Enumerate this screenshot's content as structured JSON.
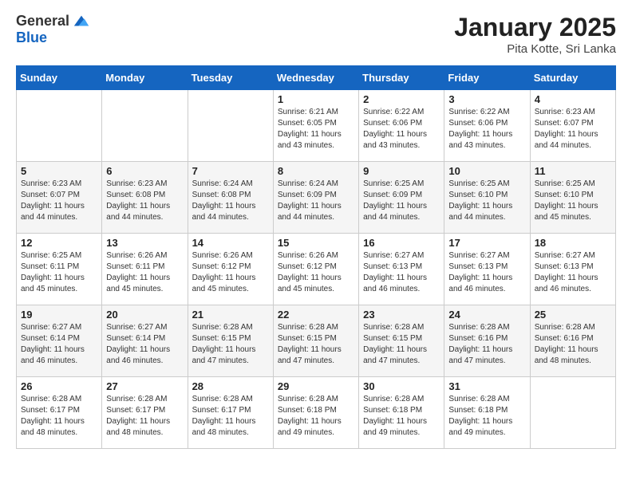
{
  "header": {
    "logo_general": "General",
    "logo_blue": "Blue",
    "title": "January 2025",
    "subtitle": "Pita Kotte, Sri Lanka"
  },
  "days_of_week": [
    "Sunday",
    "Monday",
    "Tuesday",
    "Wednesday",
    "Thursday",
    "Friday",
    "Saturday"
  ],
  "weeks": [
    [
      {
        "day": "",
        "info": ""
      },
      {
        "day": "",
        "info": ""
      },
      {
        "day": "",
        "info": ""
      },
      {
        "day": "1",
        "info": "Sunrise: 6:21 AM\nSunset: 6:05 PM\nDaylight: 11 hours and 43 minutes."
      },
      {
        "day": "2",
        "info": "Sunrise: 6:22 AM\nSunset: 6:06 PM\nDaylight: 11 hours and 43 minutes."
      },
      {
        "day": "3",
        "info": "Sunrise: 6:22 AM\nSunset: 6:06 PM\nDaylight: 11 hours and 43 minutes."
      },
      {
        "day": "4",
        "info": "Sunrise: 6:23 AM\nSunset: 6:07 PM\nDaylight: 11 hours and 44 minutes."
      }
    ],
    [
      {
        "day": "5",
        "info": "Sunrise: 6:23 AM\nSunset: 6:07 PM\nDaylight: 11 hours and 44 minutes."
      },
      {
        "day": "6",
        "info": "Sunrise: 6:23 AM\nSunset: 6:08 PM\nDaylight: 11 hours and 44 minutes."
      },
      {
        "day": "7",
        "info": "Sunrise: 6:24 AM\nSunset: 6:08 PM\nDaylight: 11 hours and 44 minutes."
      },
      {
        "day": "8",
        "info": "Sunrise: 6:24 AM\nSunset: 6:09 PM\nDaylight: 11 hours and 44 minutes."
      },
      {
        "day": "9",
        "info": "Sunrise: 6:25 AM\nSunset: 6:09 PM\nDaylight: 11 hours and 44 minutes."
      },
      {
        "day": "10",
        "info": "Sunrise: 6:25 AM\nSunset: 6:10 PM\nDaylight: 11 hours and 44 minutes."
      },
      {
        "day": "11",
        "info": "Sunrise: 6:25 AM\nSunset: 6:10 PM\nDaylight: 11 hours and 45 minutes."
      }
    ],
    [
      {
        "day": "12",
        "info": "Sunrise: 6:25 AM\nSunset: 6:11 PM\nDaylight: 11 hours and 45 minutes."
      },
      {
        "day": "13",
        "info": "Sunrise: 6:26 AM\nSunset: 6:11 PM\nDaylight: 11 hours and 45 minutes."
      },
      {
        "day": "14",
        "info": "Sunrise: 6:26 AM\nSunset: 6:12 PM\nDaylight: 11 hours and 45 minutes."
      },
      {
        "day": "15",
        "info": "Sunrise: 6:26 AM\nSunset: 6:12 PM\nDaylight: 11 hours and 45 minutes."
      },
      {
        "day": "16",
        "info": "Sunrise: 6:27 AM\nSunset: 6:13 PM\nDaylight: 11 hours and 46 minutes."
      },
      {
        "day": "17",
        "info": "Sunrise: 6:27 AM\nSunset: 6:13 PM\nDaylight: 11 hours and 46 minutes."
      },
      {
        "day": "18",
        "info": "Sunrise: 6:27 AM\nSunset: 6:13 PM\nDaylight: 11 hours and 46 minutes."
      }
    ],
    [
      {
        "day": "19",
        "info": "Sunrise: 6:27 AM\nSunset: 6:14 PM\nDaylight: 11 hours and 46 minutes."
      },
      {
        "day": "20",
        "info": "Sunrise: 6:27 AM\nSunset: 6:14 PM\nDaylight: 11 hours and 46 minutes."
      },
      {
        "day": "21",
        "info": "Sunrise: 6:28 AM\nSunset: 6:15 PM\nDaylight: 11 hours and 47 minutes."
      },
      {
        "day": "22",
        "info": "Sunrise: 6:28 AM\nSunset: 6:15 PM\nDaylight: 11 hours and 47 minutes."
      },
      {
        "day": "23",
        "info": "Sunrise: 6:28 AM\nSunset: 6:15 PM\nDaylight: 11 hours and 47 minutes."
      },
      {
        "day": "24",
        "info": "Sunrise: 6:28 AM\nSunset: 6:16 PM\nDaylight: 11 hours and 47 minutes."
      },
      {
        "day": "25",
        "info": "Sunrise: 6:28 AM\nSunset: 6:16 PM\nDaylight: 11 hours and 48 minutes."
      }
    ],
    [
      {
        "day": "26",
        "info": "Sunrise: 6:28 AM\nSunset: 6:17 PM\nDaylight: 11 hours and 48 minutes."
      },
      {
        "day": "27",
        "info": "Sunrise: 6:28 AM\nSunset: 6:17 PM\nDaylight: 11 hours and 48 minutes."
      },
      {
        "day": "28",
        "info": "Sunrise: 6:28 AM\nSunset: 6:17 PM\nDaylight: 11 hours and 48 minutes."
      },
      {
        "day": "29",
        "info": "Sunrise: 6:28 AM\nSunset: 6:18 PM\nDaylight: 11 hours and 49 minutes."
      },
      {
        "day": "30",
        "info": "Sunrise: 6:28 AM\nSunset: 6:18 PM\nDaylight: 11 hours and 49 minutes."
      },
      {
        "day": "31",
        "info": "Sunrise: 6:28 AM\nSunset: 6:18 PM\nDaylight: 11 hours and 49 minutes."
      },
      {
        "day": "",
        "info": ""
      }
    ]
  ]
}
